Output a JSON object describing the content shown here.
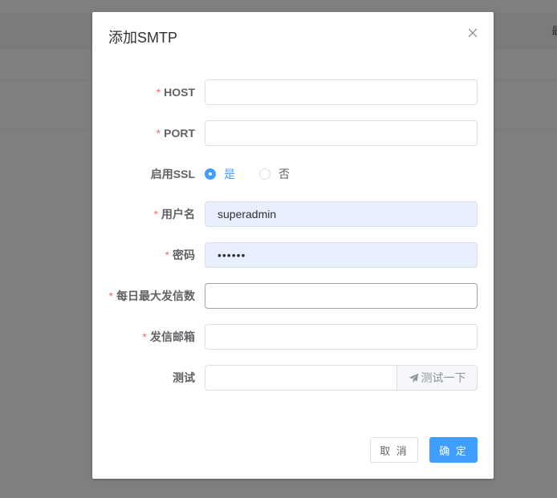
{
  "background": {
    "header_cell_partial": "最"
  },
  "dialog": {
    "title": "添加SMTP",
    "fields": {
      "host": {
        "label": "HOST",
        "value": ""
      },
      "port": {
        "label": "PORT",
        "value": ""
      },
      "ssl": {
        "label": "启用SSL",
        "options": [
          "是",
          "否"
        ],
        "selected": "是"
      },
      "username": {
        "label": "用户名",
        "value": "superadmin"
      },
      "password": {
        "label": "密码",
        "value": "••••••"
      },
      "daily_max": {
        "label": "每日最大发信数",
        "value": ""
      },
      "sender_email": {
        "label": "发信邮箱",
        "value": ""
      },
      "test": {
        "label": "测试",
        "value": "",
        "button_label": "测试一下"
      }
    },
    "required_mark": "*",
    "buttons": {
      "cancel": "取 消",
      "confirm": "确 定"
    }
  },
  "colors": {
    "primary": "#409eff",
    "required": "#f56c6c",
    "autofill": "#e8f0fe"
  },
  "icons": {
    "close": "close-icon",
    "send": "paper-plane-icon"
  }
}
